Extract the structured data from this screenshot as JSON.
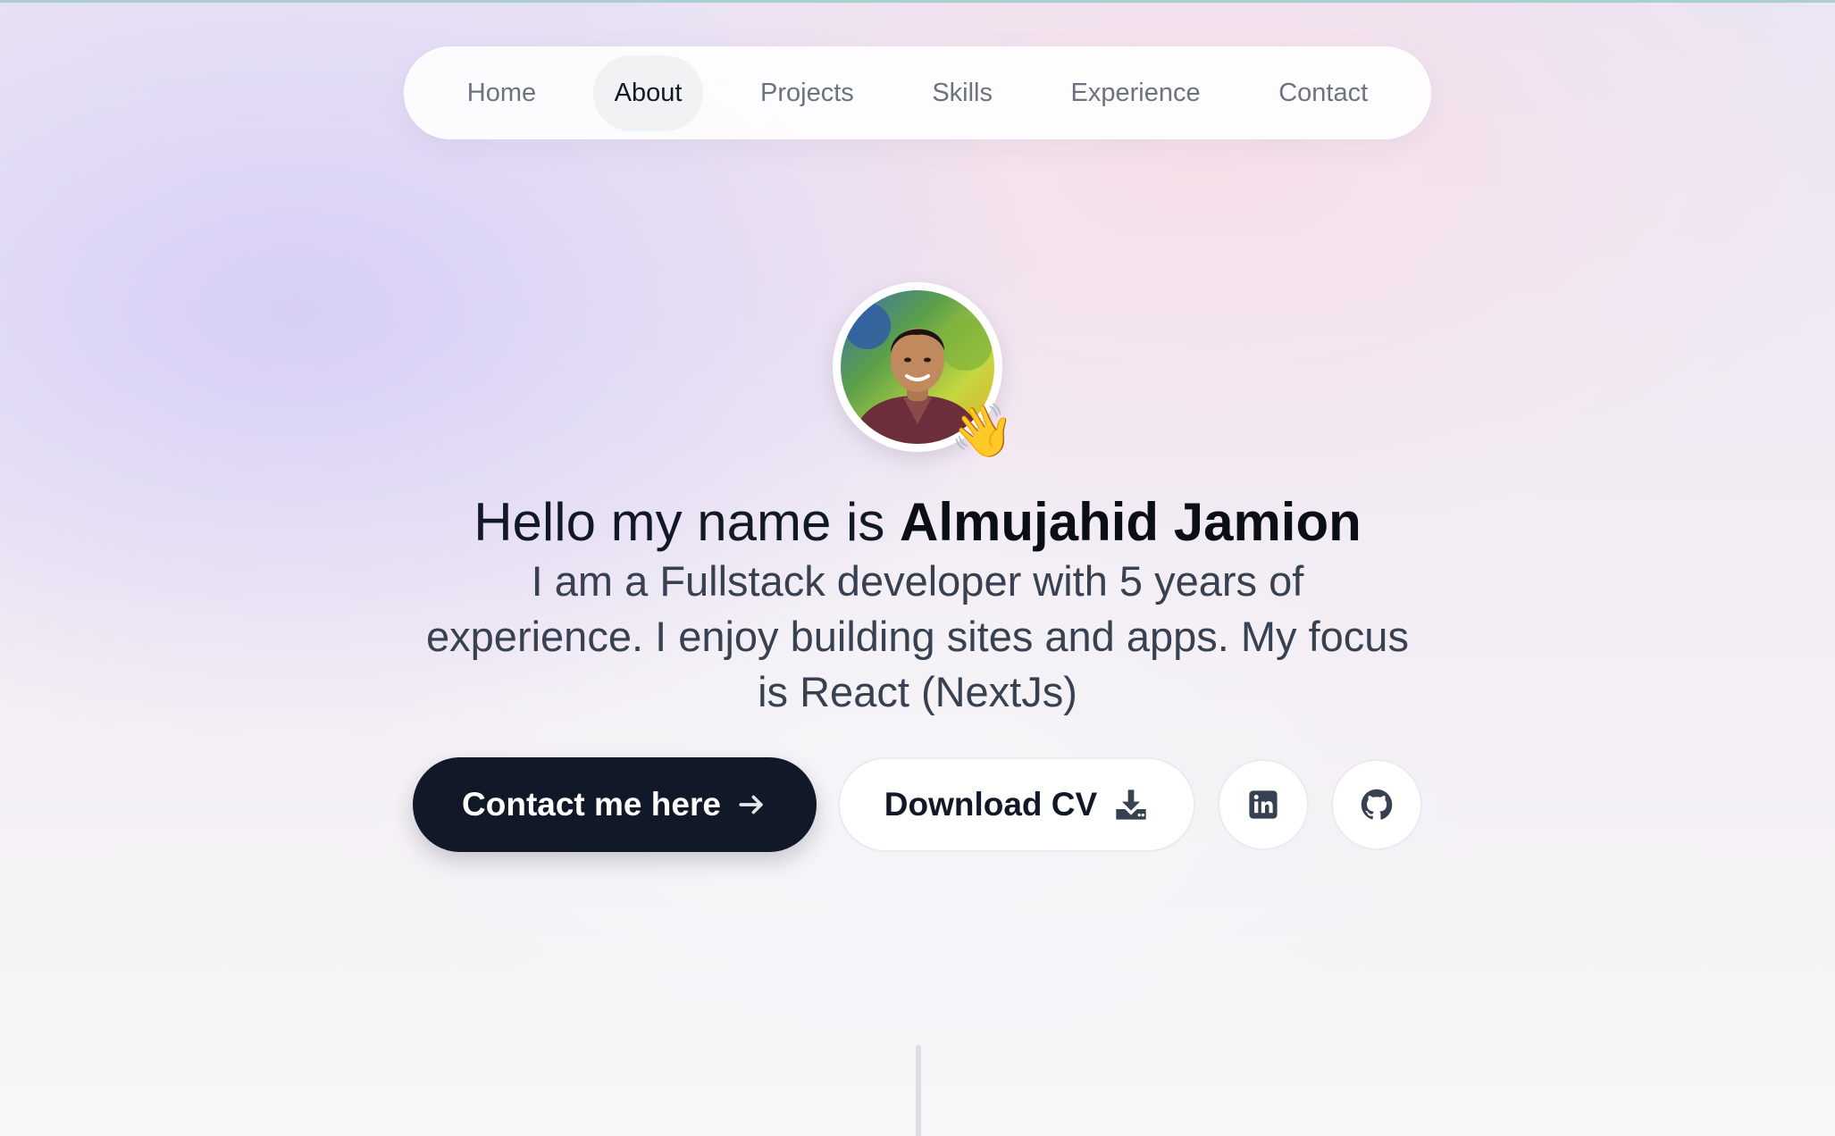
{
  "nav": {
    "items": [
      {
        "label": "Home"
      },
      {
        "label": "About",
        "active": true
      },
      {
        "label": "Projects"
      },
      {
        "label": "Skills"
      },
      {
        "label": "Experience"
      },
      {
        "label": "Contact"
      }
    ]
  },
  "hero": {
    "greeting": "Hello my name is ",
    "name": "Almujahid Jamion",
    "intro": "I am a Fullstack developer with 5 years of experience. I enjoy building sites and apps. My focus is React (NextJs)",
    "wave_emoji": "👋"
  },
  "actions": {
    "contact_label": "Contact me here",
    "cv_label": "Download CV",
    "linkedin_icon": "linkedin-icon",
    "github_icon": "github-icon"
  },
  "colors": {
    "primary_button": "#111827",
    "text_dark": "#111827",
    "text_muted": "#6b7280"
  }
}
